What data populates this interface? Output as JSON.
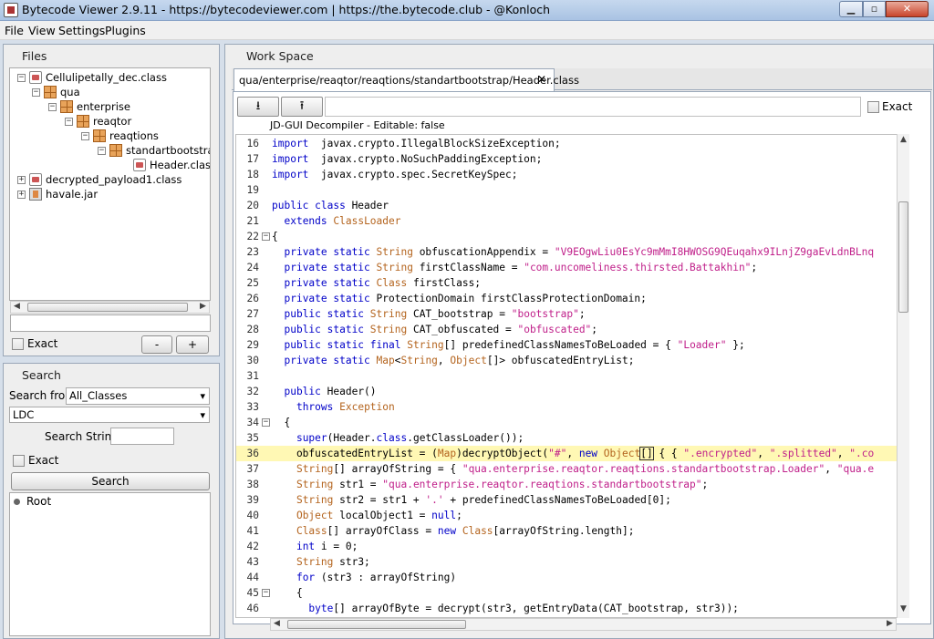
{
  "window": {
    "title": "Bytecode Viewer 2.9.11 - https://bytecodeviewer.com | https://the.bytecode.club - @Konloch",
    "min": "▁",
    "max": "▫",
    "close": "✕"
  },
  "menu": [
    "File",
    "View",
    "Settings",
    "Plugins"
  ],
  "files": {
    "title": "Files",
    "exact_label": "Exact",
    "minus_label": "-",
    "plus_label": "+",
    "search_value": "",
    "tree": [
      {
        "label": "Cellulipetally_dec.class",
        "icon": "class-file-icon",
        "toggle": "−"
      },
      {
        "label": "qua",
        "icon": "package-icon",
        "toggle": "−"
      },
      {
        "label": "enterprise",
        "icon": "package-icon",
        "toggle": "−"
      },
      {
        "label": "reaqtor",
        "icon": "package-icon",
        "toggle": "−"
      },
      {
        "label": "reaqtions",
        "icon": "package-icon",
        "toggle": "−"
      },
      {
        "label": "standartbootstrap",
        "icon": "package-icon",
        "toggle": "−"
      },
      {
        "label": "Header.class",
        "icon": "class-file-icon",
        "toggle": ""
      },
      {
        "label": "decrypted_payload1.class",
        "icon": "class-file-icon",
        "toggle": "+"
      },
      {
        "label": "havale.jar",
        "icon": "jar-file-icon",
        "toggle": "+"
      }
    ]
  },
  "search": {
    "title": "Search",
    "search_from_label": "Search from",
    "search_from_value": "All_Classes",
    "mode_value": "LDC",
    "search_string_label": "Search String:",
    "search_string_value": "",
    "exact_label": "Exact",
    "search_button": "Search",
    "results_root": "Root"
  },
  "workspace": {
    "title": "Work Space",
    "tab_label": "qua/enterprise/reaqtor/reaqtions/standartbootstrap/Header.class",
    "tab_close": "✕",
    "decompiler_label": "JD-GUI Decompiler - Editable: false",
    "exact_label": "Exact",
    "download_icon": "⭳",
    "upload_icon": "⭱"
  },
  "code": [
    {
      "n": "16",
      "fold": "",
      "hl": false,
      "segs": [
        [
          "kw",
          "import"
        ],
        [
          "",
          "  javax.crypto.IllegalBlockSizeException;"
        ]
      ]
    },
    {
      "n": "17",
      "fold": "",
      "hl": false,
      "segs": [
        [
          "kw",
          "import"
        ],
        [
          "",
          "  javax.crypto.NoSuchPaddingException;"
        ]
      ]
    },
    {
      "n": "18",
      "fold": "",
      "hl": false,
      "segs": [
        [
          "kw",
          "import"
        ],
        [
          "",
          "  javax.crypto.spec.SecretKeySpec;"
        ]
      ]
    },
    {
      "n": "19",
      "fold": "",
      "hl": false,
      "segs": []
    },
    {
      "n": "20",
      "fold": "",
      "hl": false,
      "segs": [
        [
          "kw",
          "public class"
        ],
        [
          "",
          " Header"
        ]
      ]
    },
    {
      "n": "21",
      "fold": "",
      "hl": false,
      "segs": [
        [
          "",
          "  "
        ],
        [
          "kw",
          "extends"
        ],
        [
          "",
          " "
        ],
        [
          "ty",
          "ClassLoader"
        ]
      ]
    },
    {
      "n": "22",
      "fold": "−",
      "hl": false,
      "segs": [
        [
          "",
          "{"
        ]
      ]
    },
    {
      "n": "23",
      "fold": "",
      "hl": false,
      "segs": [
        [
          "",
          "  "
        ],
        [
          "kw",
          "private static"
        ],
        [
          "",
          " "
        ],
        [
          "ty",
          "String"
        ],
        [
          "",
          " obfuscationAppendix = "
        ],
        [
          "st",
          "\"V9EOgwLiu0EsYc9mMmI8HWOSG9QEuqahx9ILnjZ9gaEvLdnBLnq"
        ]
      ]
    },
    {
      "n": "24",
      "fold": "",
      "hl": false,
      "segs": [
        [
          "",
          "  "
        ],
        [
          "kw",
          "private static"
        ],
        [
          "",
          " "
        ],
        [
          "ty",
          "String"
        ],
        [
          "",
          " firstClassName = "
        ],
        [
          "st",
          "\"com.uncomeliness.thirsted.Battakhin\""
        ],
        [
          "",
          ";"
        ]
      ]
    },
    {
      "n": "25",
      "fold": "",
      "hl": false,
      "segs": [
        [
          "",
          "  "
        ],
        [
          "kw",
          "private static"
        ],
        [
          "",
          " "
        ],
        [
          "ty",
          "Class"
        ],
        [
          "",
          " firstClass;"
        ]
      ]
    },
    {
      "n": "26",
      "fold": "",
      "hl": false,
      "segs": [
        [
          "",
          "  "
        ],
        [
          "kw",
          "private static"
        ],
        [
          "",
          " ProtectionDomain firstClassProtectionDomain;"
        ]
      ]
    },
    {
      "n": "27",
      "fold": "",
      "hl": false,
      "segs": [
        [
          "",
          "  "
        ],
        [
          "kw",
          "public static"
        ],
        [
          "",
          " "
        ],
        [
          "ty",
          "String"
        ],
        [
          "",
          " CAT_bootstrap = "
        ],
        [
          "st",
          "\"bootstrap\""
        ],
        [
          "",
          ";"
        ]
      ]
    },
    {
      "n": "28",
      "fold": "",
      "hl": false,
      "segs": [
        [
          "",
          "  "
        ],
        [
          "kw",
          "public static"
        ],
        [
          "",
          " "
        ],
        [
          "ty",
          "String"
        ],
        [
          "",
          " CAT_obfuscated = "
        ],
        [
          "st",
          "\"obfuscated\""
        ],
        [
          "",
          ";"
        ]
      ]
    },
    {
      "n": "29",
      "fold": "",
      "hl": false,
      "segs": [
        [
          "",
          "  "
        ],
        [
          "kw",
          "public static final"
        ],
        [
          "",
          " "
        ],
        [
          "ty",
          "String"
        ],
        [
          "",
          "[] predefinedClassNamesToBeLoaded = { "
        ],
        [
          "st",
          "\"Loader\""
        ],
        [
          "",
          " };"
        ]
      ]
    },
    {
      "n": "30",
      "fold": "",
      "hl": false,
      "segs": [
        [
          "",
          "  "
        ],
        [
          "kw",
          "private static"
        ],
        [
          "",
          " "
        ],
        [
          "ty",
          "Map"
        ],
        [
          "",
          "<"
        ],
        [
          "ty",
          "String"
        ],
        [
          "",
          ", "
        ],
        [
          "ty",
          "Object"
        ],
        [
          "",
          "[]> obfuscatedEntryList;"
        ]
      ]
    },
    {
      "n": "31",
      "fold": "",
      "hl": false,
      "segs": []
    },
    {
      "n": "32",
      "fold": "",
      "hl": false,
      "segs": [
        [
          "",
          "  "
        ],
        [
          "kw",
          "public"
        ],
        [
          "",
          " Header()"
        ]
      ]
    },
    {
      "n": "33",
      "fold": "",
      "hl": false,
      "segs": [
        [
          "",
          "    "
        ],
        [
          "kw",
          "throws"
        ],
        [
          "",
          " "
        ],
        [
          "ty",
          "Exception"
        ]
      ]
    },
    {
      "n": "34",
      "fold": "−",
      "hl": false,
      "segs": [
        [
          "",
          "  {"
        ]
      ]
    },
    {
      "n": "35",
      "fold": "",
      "hl": false,
      "segs": [
        [
          "",
          "    "
        ],
        [
          "kw",
          "super"
        ],
        [
          "",
          "(Header."
        ],
        [
          "kw",
          "class"
        ],
        [
          "",
          ".getClassLoader());"
        ]
      ]
    },
    {
      "n": "36",
      "fold": "",
      "hl": true,
      "segs": [
        [
          "",
          "    obfuscatedEntryList = ("
        ],
        [
          "ty",
          "Map"
        ],
        [
          "",
          ")decryptObject("
        ],
        [
          "st",
          "\"#\""
        ],
        [
          "",
          ", "
        ],
        [
          "kw",
          "new"
        ],
        [
          "",
          " "
        ],
        [
          "ty",
          "Object"
        ],
        [
          "cursor",
          "[]"
        ],
        [
          "",
          " { { "
        ],
        [
          "st",
          "\".encrypted\""
        ],
        [
          "",
          ", "
        ],
        [
          "st",
          "\".splitted\""
        ],
        [
          "",
          ", "
        ],
        [
          "st",
          "\".co"
        ]
      ]
    },
    {
      "n": "37",
      "fold": "",
      "hl": false,
      "segs": [
        [
          "",
          "    "
        ],
        [
          "ty",
          "String"
        ],
        [
          "",
          "[] arrayOfString = { "
        ],
        [
          "st",
          "\"qua.enterprise.reaqtor.reaqtions.standartbootstrap.Loader\""
        ],
        [
          "",
          ", "
        ],
        [
          "st",
          "\"qua.e"
        ]
      ]
    },
    {
      "n": "38",
      "fold": "",
      "hl": false,
      "segs": [
        [
          "",
          "    "
        ],
        [
          "ty",
          "String"
        ],
        [
          "",
          " str1 = "
        ],
        [
          "st",
          "\"qua.enterprise.reaqtor.reaqtions.standartbootstrap\""
        ],
        [
          "",
          ";"
        ]
      ]
    },
    {
      "n": "39",
      "fold": "",
      "hl": false,
      "segs": [
        [
          "",
          "    "
        ],
        [
          "ty",
          "String"
        ],
        [
          "",
          " str2 = str1 + "
        ],
        [
          "st",
          "'.'"
        ],
        [
          "",
          " + predefinedClassNamesToBeLoaded[0];"
        ]
      ]
    },
    {
      "n": "40",
      "fold": "",
      "hl": false,
      "segs": [
        [
          "",
          "    "
        ],
        [
          "ty",
          "Object"
        ],
        [
          "",
          " localObject1 = "
        ],
        [
          "kw",
          "null"
        ],
        [
          "",
          ";"
        ]
      ]
    },
    {
      "n": "41",
      "fold": "",
      "hl": false,
      "segs": [
        [
          "",
          "    "
        ],
        [
          "ty",
          "Class"
        ],
        [
          "",
          "[] arrayOfClass = "
        ],
        [
          "kw",
          "new"
        ],
        [
          "",
          " "
        ],
        [
          "ty",
          "Class"
        ],
        [
          "",
          "[arrayOfString.length];"
        ]
      ]
    },
    {
      "n": "42",
      "fold": "",
      "hl": false,
      "segs": [
        [
          "",
          "    "
        ],
        [
          "kw",
          "int"
        ],
        [
          "",
          " i = 0;"
        ]
      ]
    },
    {
      "n": "43",
      "fold": "",
      "hl": false,
      "segs": [
        [
          "",
          "    "
        ],
        [
          "ty",
          "String"
        ],
        [
          "",
          " str3;"
        ]
      ]
    },
    {
      "n": "44",
      "fold": "",
      "hl": false,
      "segs": [
        [
          "",
          "    "
        ],
        [
          "kw",
          "for"
        ],
        [
          "",
          " (str3 : arrayOfString)"
        ]
      ]
    },
    {
      "n": "45",
      "fold": "−",
      "hl": false,
      "segs": [
        [
          "",
          "    {"
        ]
      ]
    },
    {
      "n": "46",
      "fold": "",
      "hl": false,
      "segs": [
        [
          "",
          "      "
        ],
        [
          "kw",
          "byte"
        ],
        [
          "",
          "[] arrayOfByte = decrypt(str3, getEntryData(CAT_bootstrap, str3));"
        ]
      ]
    }
  ]
}
